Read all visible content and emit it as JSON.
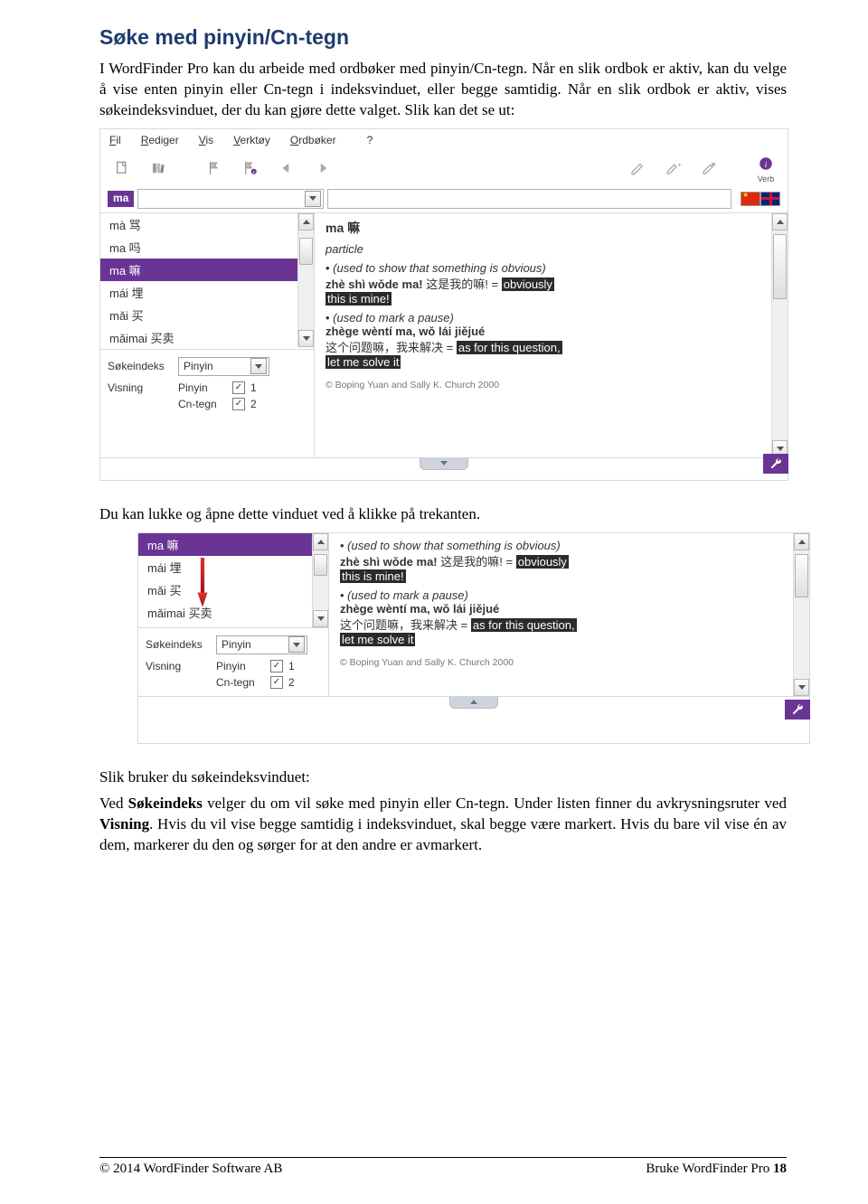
{
  "heading": "Søke med pinyin/Cn-tegn",
  "para1": "I WordFinder Pro kan du arbeide med ordbøker med pinyin/Cn-tegn. Når en slik ordbok er aktiv, kan du velge å vise enten pinyin eller Cn-tegn i indeksvinduet, eller begge samtidig. Når en slik ordbok er aktiv, vises søkeindeksvinduet, der du kan gjøre dette valget. Slik kan det se ut:",
  "para2": "Du kan lukke og åpne dette vinduet ved å klikke på trekanten.",
  "para3": "Slik bruker du søkeindeksvinduet:",
  "para4_a": "Ved ",
  "para4_b": "Søkeindeks",
  "para4_c": " velger du om vil søke med pinyin eller Cn-tegn. Under listen finner du avkrysningsruter ved ",
  "para4_d": "Visning",
  "para4_e": ". Hvis du vil vise begge samtidig i indeksvinduet, skal begge være markert. Hvis du bare vil vise én av dem, markerer  du den og sørger for at den andre er avmarkert.",
  "menu": {
    "fil": "Fil",
    "rediger": "Rediger",
    "vis": "Vis",
    "verktoy": "Verktøy",
    "ordboker": "Ordbøker",
    "help": "?"
  },
  "search_tag": "ma",
  "list1": [
    "mà  骂",
    "ma  吗",
    "ma  嘛",
    "mái  埋",
    "mǎi  买",
    "mǎimai  买卖"
  ],
  "list1_selected": 2,
  "opts": {
    "sokeindeks_label": "Søkeindeks",
    "sokeindeks_value": "Pinyin",
    "visning_label": "Visning",
    "chk1_label": "Pinyin",
    "chk1_num": "1",
    "chk2_label": "Cn-tegn",
    "chk2_num": "2"
  },
  "entry": {
    "headword": "ma 嘛",
    "pos": "particle",
    "sense1_gloss": "(used to show that something is obvious)",
    "sense1_ex_pinyin": "zhè shì wǒde ma!",
    "sense1_ex_cn": "这是我的嘛!",
    "sense1_ex_eq": "= ",
    "sense1_trans1": "obviously",
    "sense1_trans2": "this is mine!",
    "sense2_gloss": "(used to mark a pause)",
    "sense2_ex_pinyin": "zhège wèntí ma, wǒ lái jiějué",
    "sense2_cn": "这个问题嘛，我来解决",
    "sense2_eq": " = ",
    "sense2_trans1": "as for this question,",
    "sense2_trans2": "let me solve it",
    "credit": "© Boping Yuan and Sally K. Church 2000"
  },
  "list2": [
    "ma  嘛",
    "mái  埋",
    "mǎi  买",
    "mǎimai  买卖"
  ],
  "list2_selected": 0,
  "verb_label": "Verb",
  "footer_left": "© 2014 WordFinder Software AB",
  "footer_right_a": "Bruke WordFinder Pro ",
  "footer_right_b": "18"
}
